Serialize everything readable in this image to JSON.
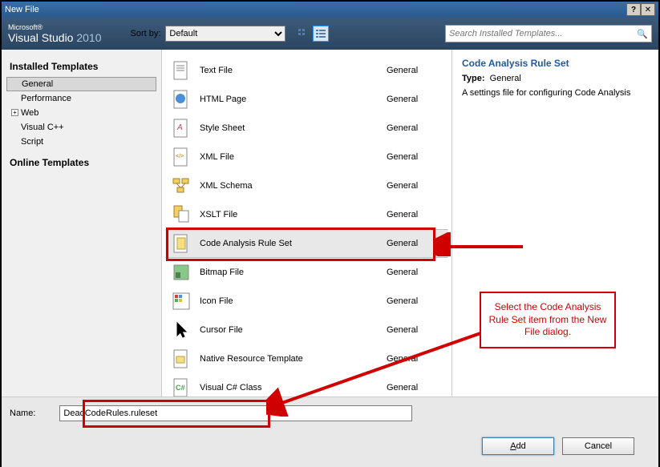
{
  "window": {
    "title": "New File"
  },
  "header": {
    "logo_ms": "Microsoft®",
    "logo_vs": "Visual Studio",
    "logo_year": "2010",
    "sortby_label": "Sort by:",
    "sortby_value": "Default",
    "search_placeholder": "Search Installed Templates..."
  },
  "sidebar": {
    "groups": {
      "installed": "Installed Templates",
      "online": "Online Templates"
    },
    "items": {
      "general": "General",
      "performance": "Performance",
      "web": "Web",
      "vcpp": "Visual C++",
      "script": "Script"
    }
  },
  "templates": [
    {
      "name": "Text File",
      "category": "General"
    },
    {
      "name": "HTML Page",
      "category": "General"
    },
    {
      "name": "Style Sheet",
      "category": "General"
    },
    {
      "name": "XML File",
      "category": "General"
    },
    {
      "name": "XML Schema",
      "category": "General"
    },
    {
      "name": "XSLT File",
      "category": "General"
    },
    {
      "name": "Code Analysis Rule Set",
      "category": "General"
    },
    {
      "name": "Bitmap File",
      "category": "General"
    },
    {
      "name": "Icon File",
      "category": "General"
    },
    {
      "name": "Cursor File",
      "category": "General"
    },
    {
      "name": "Native Resource Template",
      "category": "General"
    },
    {
      "name": "Visual C# Class",
      "category": "General"
    }
  ],
  "detail": {
    "title": "Code Analysis Rule Set",
    "type_label": "Type:",
    "type_value": "General",
    "description": "A settings file for configuring Code Analysis"
  },
  "footer": {
    "name_label": "Name:",
    "name_value": "DeadCodeRules.ruleset",
    "add": "Add",
    "cancel": "Cancel"
  },
  "annotations": {
    "callout": "Select the Code Analysis Rule Set item from the New File dialog."
  }
}
